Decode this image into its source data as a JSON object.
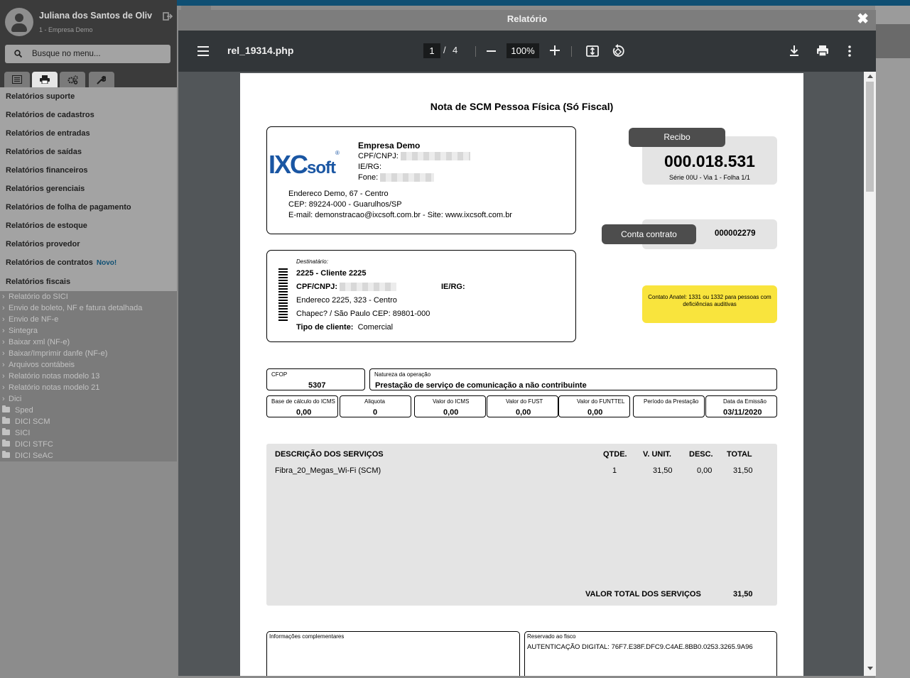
{
  "sidebar": {
    "user_name": "Juliana dos Santos de Oliv",
    "company": "1 - Empresa Demo",
    "search_placeholder": "Busque no menu...",
    "tabs": [
      "list-icon",
      "print-icon",
      "cogs-icon",
      "wrench-icon"
    ],
    "menu": [
      "Relatórios suporte",
      "Relatórios de cadastros",
      "Relatórios de entradas",
      "Relatórios de saídas",
      "Relatórios financeiros",
      "Relatórios gerenciais",
      "Relatórios de folha de pagamento",
      "Relatórios de estoque",
      "Relatórios provedor",
      "Relatórios de contratos",
      "Relatórios fiscais"
    ],
    "new_badge": "Novo!",
    "submenu": [
      "Relatório do SICI",
      "Envio de boleto, NF e fatura detalhada",
      "Envio de NF-e",
      "Sintegra",
      "Baixar xml (NF-e)",
      "Baixar/Imprimir danfe (NF-e)",
      "Arquivos contábeis",
      "Relatório notas modelo 13",
      "Relatório notas modelo 21",
      "Dici"
    ],
    "folders": [
      "Sped",
      "DICI SCM",
      "SICI",
      "DICI STFC",
      "DICI SeAC"
    ]
  },
  "modal": {
    "title": "Relatório",
    "close": "✖"
  },
  "viewer": {
    "file_name": "rel_19314.php",
    "page_current": "1",
    "page_sep": "/",
    "page_total": "4",
    "zoom": "100%"
  },
  "document": {
    "title": "Nota de SCM Pessoa Física  (Só Fiscal)",
    "emitter": {
      "name": "Empresa Demo",
      "cpf_label": "CPF/CNPJ:",
      "ie_label": "IE/RG:",
      "phone_label": "Fone:",
      "address": "Endereco Demo, 67 - Centro",
      "cep": "CEP: 89224-000 - Guarulhos/SP",
      "email": "E-mail: demonstracao@ixcsoft.com.br - Site: www.ixcsoft.com.br",
      "logo_main": "IXC",
      "logo_sub": "soft",
      "logo_reg": "®"
    },
    "receipt": {
      "tag": "Recibo",
      "number": "000.018.531",
      "series": "Série 00U - Via 1 - Folha 1/1"
    },
    "contract": {
      "tag": "Conta contrato",
      "number": "000002279"
    },
    "recipient": {
      "label": "Destinatário:",
      "name": "2225 - Cliente 2225",
      "cpf_label": "CPF/CNPJ:",
      "ie_label": "IE/RG:",
      "address": "Endereco 2225, 323  - Centro",
      "city": "Chapec? / São Paulo  CEP: 89801-000",
      "type_label": "Tipo de cliente:",
      "type_value": "Comercial"
    },
    "anatel": "Contato Anatel: 1331 ou 1332 para pessoas com deficiências auditivas",
    "cfop": {
      "label": "CFOP",
      "value": "5307"
    },
    "natureza": {
      "label": "Natureza da operação",
      "value": "Prestação de serviço de comunicação a não contribuinte"
    },
    "tax_fields": [
      {
        "label": "Base de cálculo do ICMS",
        "value": "0,00"
      },
      {
        "label": "Aliquota",
        "value": "0"
      },
      {
        "label": "Valor do ICMS",
        "value": "0,00"
      },
      {
        "label": "Valor do FUST",
        "value": "0,00"
      },
      {
        "label": "Valor do FUNTTEL",
        "value": "0,00"
      },
      {
        "label": "Período da Prestação",
        "value": ""
      },
      {
        "label": "Data da Emissão",
        "value": "03/11/2020"
      }
    ],
    "services": {
      "headers": {
        "desc": "DESCRIÇÃO DOS SERVIÇOS",
        "qty": "QTDE.",
        "unit": "V. UNIT.",
        "disc": "DESC.",
        "total": "TOTAL"
      },
      "rows": [
        {
          "desc": "Fibra_20_Megas_Wi-Fi (SCM)",
          "qty": "1",
          "unit": "31,50",
          "disc": "0,00",
          "total": "31,50"
        }
      ],
      "total_label": "VALOR TOTAL DOS SERVIÇOS",
      "total_value": "31,50"
    },
    "info": {
      "label": "Informações complementares"
    },
    "fisco": {
      "label": "Reservado ao fisco",
      "value": "AUTENTICAÇÃO DIGITAL: 76F7.E38F.DFC9.C4AE.8BB0.0253.3265.9A96"
    }
  }
}
